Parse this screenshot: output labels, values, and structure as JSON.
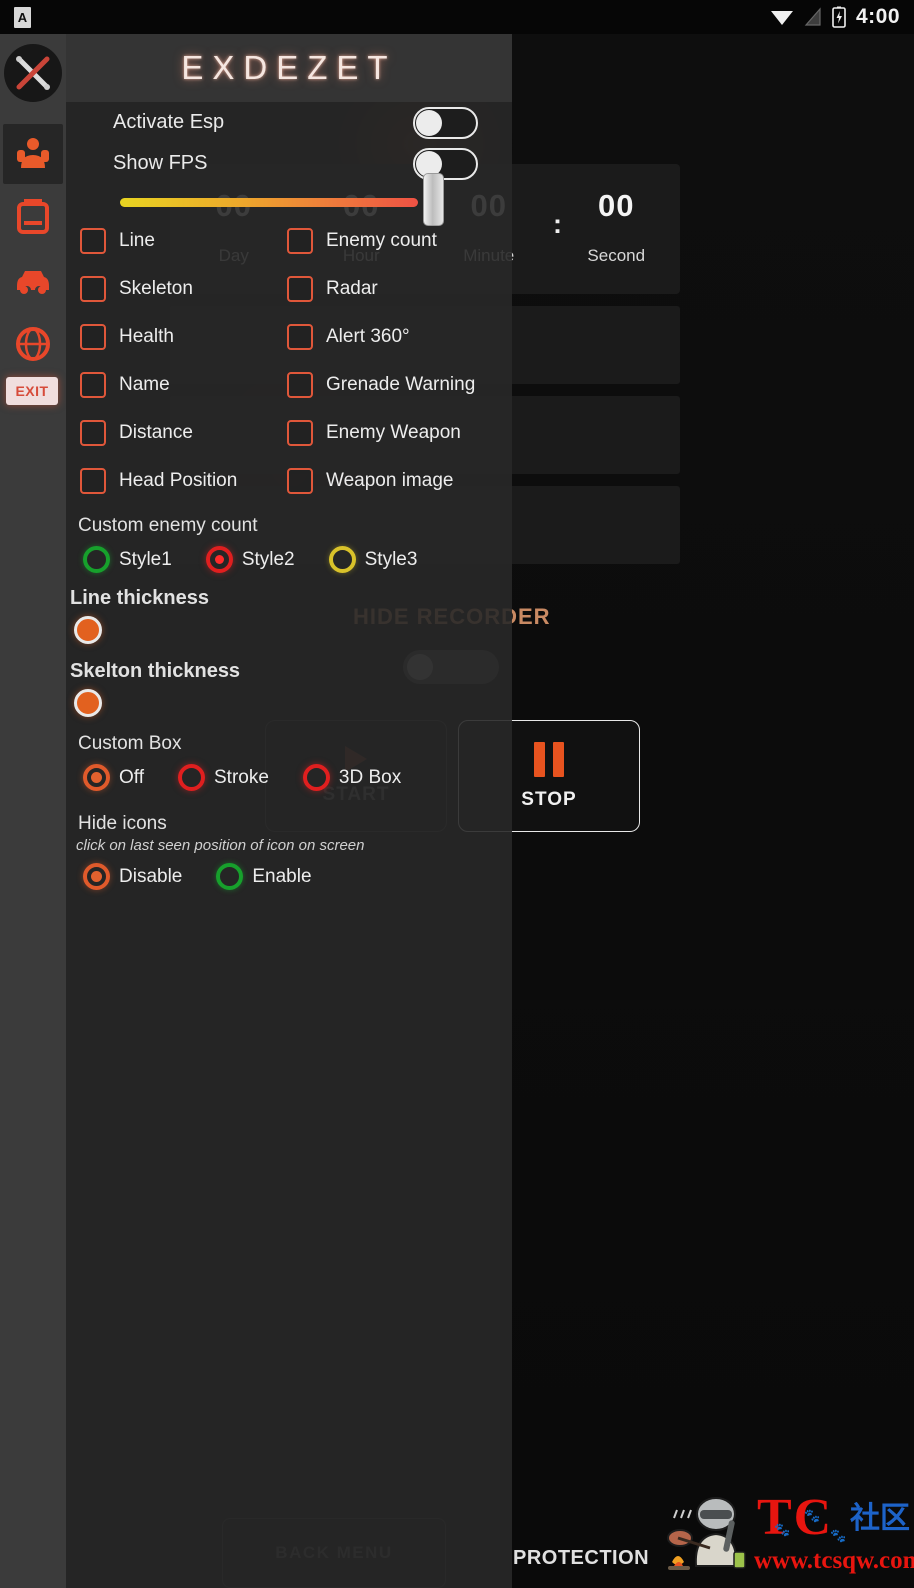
{
  "statusbar": {
    "notification_icon": "app-letter-a-icon",
    "wifi_icon": "wifi-icon",
    "signal_icon": "signal-icon",
    "battery_icon": "battery-charging-icon",
    "time": "4:00"
  },
  "rail": {
    "logo_icon": "crossed-weapons-logo-icon",
    "items": [
      {
        "name": "sidebar-item-esp",
        "icon": "soldier-icon",
        "active": true
      },
      {
        "name": "sidebar-item-items",
        "icon": "backpack-icon",
        "active": false
      },
      {
        "name": "sidebar-item-vehicle",
        "icon": "car-icon",
        "active": false
      },
      {
        "name": "sidebar-item-aimbot",
        "icon": "aim-globe-icon",
        "active": false
      }
    ],
    "exit_label": "EXIT"
  },
  "panel": {
    "title": "EXDEZET",
    "toggles": [
      {
        "label": "Activate Esp",
        "on": false
      },
      {
        "label": "Show FPS",
        "on": false
      }
    ],
    "slider": {
      "name": "esp-range-slider",
      "value_position_pct": 100
    },
    "checks_left": [
      {
        "label": "Line",
        "checked": false
      },
      {
        "label": "Skeleton",
        "checked": false
      },
      {
        "label": "Health",
        "checked": false
      },
      {
        "label": "Name",
        "checked": false
      },
      {
        "label": "Distance",
        "checked": false
      },
      {
        "label": "Head Position",
        "checked": false
      }
    ],
    "checks_right": [
      {
        "label": "Enemy count",
        "checked": false
      },
      {
        "label": "Radar",
        "checked": false
      },
      {
        "label": "Alert 360°",
        "checked": false
      },
      {
        "label": "Grenade Warning",
        "checked": false
      },
      {
        "label": "Enemy Weapon",
        "checked": false
      },
      {
        "label": "Weapon image",
        "checked": false
      }
    ],
    "custom_enemy_count": {
      "title": "Custom enemy count",
      "options": [
        {
          "label": "Style1",
          "color": "#17a02c",
          "selected": false
        },
        {
          "label": "Style2",
          "color": "#e01f1f",
          "selected": true
        },
        {
          "label": "Style3",
          "color": "#d9c22a",
          "selected": false
        }
      ]
    },
    "line_thickness": {
      "title": "Line thickness",
      "knob_color": "#e2611f",
      "value_position_pct": 0
    },
    "skelton_thickness": {
      "title": "Skelton thickness",
      "knob_color": "#e2611f",
      "value_position_pct": 0
    },
    "custom_box": {
      "title": "Custom Box",
      "options": [
        {
          "label": "Off",
          "selected": true
        },
        {
          "label": "Stroke",
          "selected": false
        },
        {
          "label": "3D Box",
          "selected": false
        }
      ]
    },
    "hide_icons": {
      "title": "Hide icons",
      "hint": "click on last seen position of icon on screen",
      "options": [
        {
          "label": "Disable",
          "selected": true
        },
        {
          "label": "Enable",
          "selected": false
        }
      ]
    }
  },
  "background": {
    "timer": {
      "cells": [
        {
          "value": "00",
          "label": "Day"
        },
        {
          "value": "00",
          "label": "Hour"
        },
        {
          "value": "00",
          "label": "Minute"
        },
        {
          "value": "00",
          "label": "Second"
        }
      ],
      "separator": ":"
    },
    "hide_recorder_label": "HIDE RECORDER",
    "start_label": "START",
    "stop_label": "STOP",
    "back_menu_label": "BACK MENU",
    "protection_label": "PROTECTION"
  },
  "watermark": {
    "brand": "TC",
    "brand_cn": "社区",
    "url": "www.tcsqw.com"
  }
}
